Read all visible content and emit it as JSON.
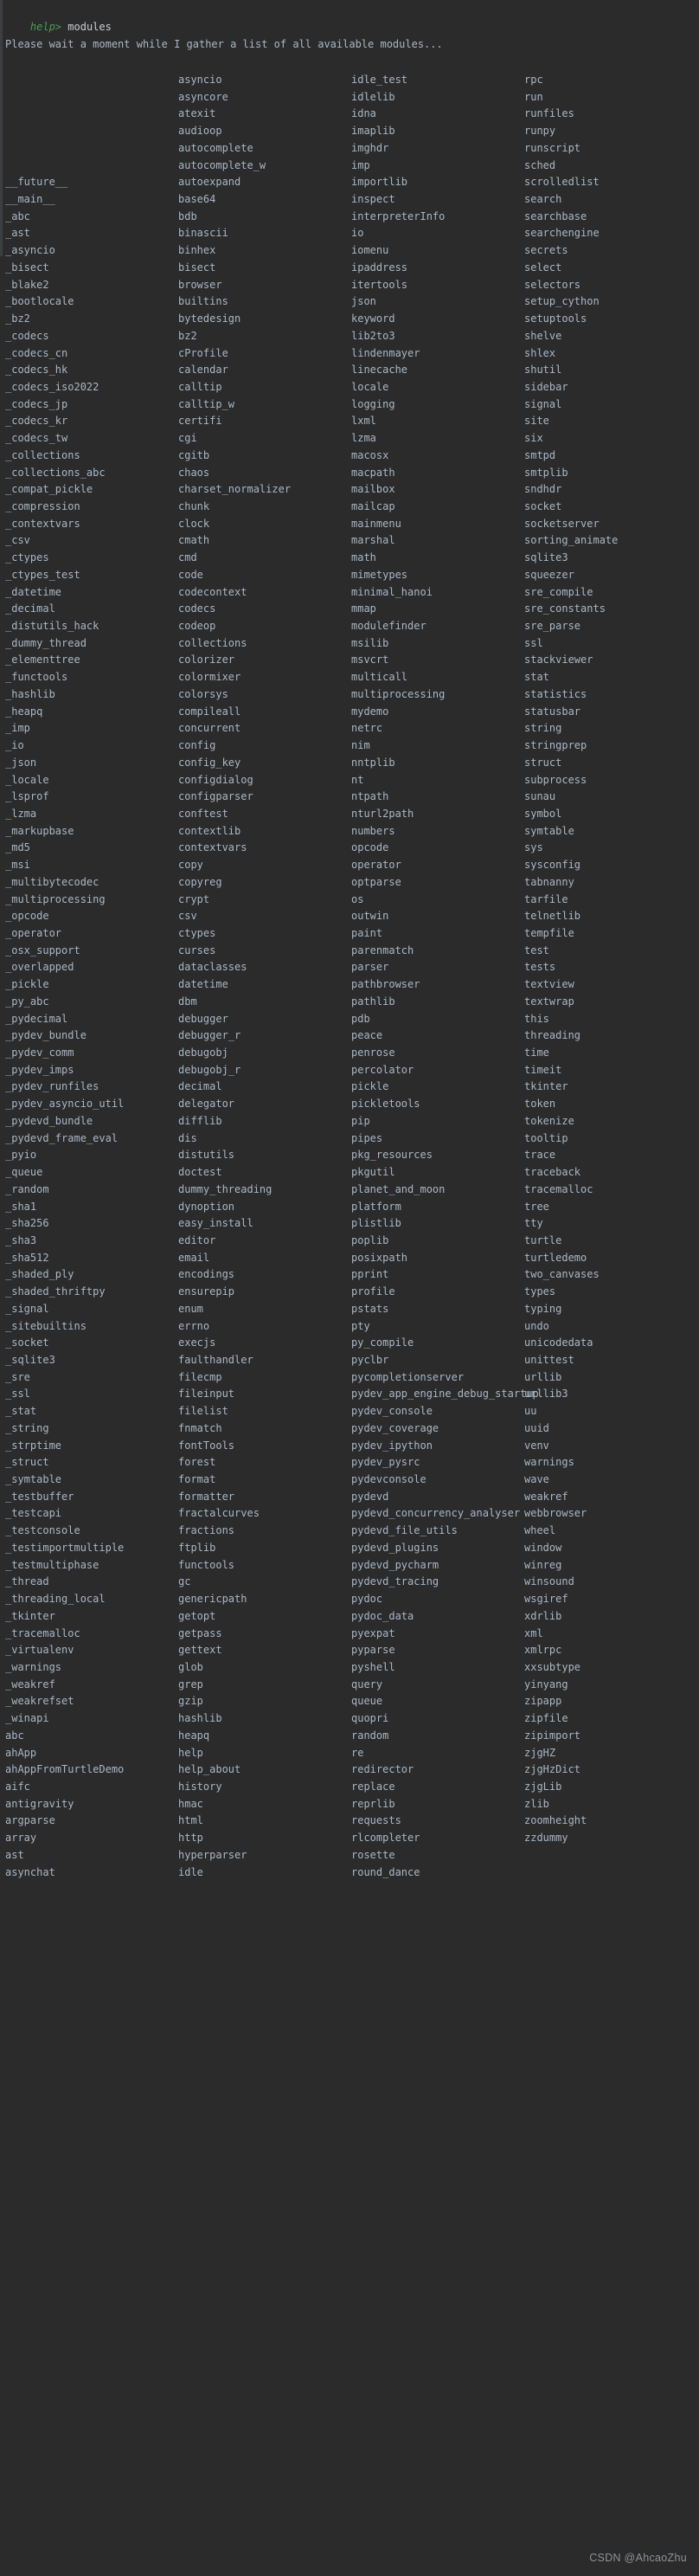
{
  "terminal": {
    "prompt_label": "help>",
    "command": "modules",
    "message": "Please wait a moment while I gather a list of all available modules...",
    "watermark": "CSDN @AhcaoZhu",
    "colors": {
      "background": "#2b2b2b",
      "foreground": "#a9b7c6",
      "prompt": "#499c54",
      "command": "#c8cdd2",
      "watermark": "#8d9299",
      "gutter": "#3c3f41"
    }
  },
  "module_table": {
    "columns": 4,
    "rows": [
      [
        "",
        "asyncio",
        "idle_test",
        "rpc"
      ],
      [
        "",
        "asyncore",
        "idlelib",
        "run"
      ],
      [
        "",
        "atexit",
        "idna",
        "runfiles"
      ],
      [
        "",
        "audioop",
        "imaplib",
        "runpy"
      ],
      [
        "",
        "autocomplete",
        "imghdr",
        "runscript"
      ],
      [
        "",
        "autocomplete_w",
        "imp",
        "sched"
      ],
      [
        "__future__",
        "autoexpand",
        "importlib",
        "scrolledlist"
      ],
      [
        "__main__",
        "base64",
        "inspect",
        "search"
      ],
      [
        "_abc",
        "bdb",
        "interpreterInfo",
        "searchbase"
      ],
      [
        "_ast",
        "binascii",
        "io",
        "searchengine"
      ],
      [
        "_asyncio",
        "binhex",
        "iomenu",
        "secrets"
      ],
      [
        "_bisect",
        "bisect",
        "ipaddress",
        "select"
      ],
      [
        "_blake2",
        "browser",
        "itertools",
        "selectors"
      ],
      [
        "_bootlocale",
        "builtins",
        "json",
        "setup_cython"
      ],
      [
        "_bz2",
        "bytedesign",
        "keyword",
        "setuptools"
      ],
      [
        "_codecs",
        "bz2",
        "lib2to3",
        "shelve"
      ],
      [
        "_codecs_cn",
        "cProfile",
        "lindenmayer",
        "shlex"
      ],
      [
        "_codecs_hk",
        "calendar",
        "linecache",
        "shutil"
      ],
      [
        "_codecs_iso2022",
        "calltip",
        "locale",
        "sidebar"
      ],
      [
        "_codecs_jp",
        "calltip_w",
        "logging",
        "signal"
      ],
      [
        "_codecs_kr",
        "certifi",
        "lxml",
        "site"
      ],
      [
        "_codecs_tw",
        "cgi",
        "lzma",
        "six"
      ],
      [
        "_collections",
        "cgitb",
        "macosx",
        "smtpd"
      ],
      [
        "_collections_abc",
        "chaos",
        "macpath",
        "smtplib"
      ],
      [
        "_compat_pickle",
        "charset_normalizer",
        "mailbox",
        "sndhdr"
      ],
      [
        "_compression",
        "chunk",
        "mailcap",
        "socket"
      ],
      [
        "_contextvars",
        "clock",
        "mainmenu",
        "socketserver"
      ],
      [
        "_csv",
        "cmath",
        "marshal",
        "sorting_animate"
      ],
      [
        "_ctypes",
        "cmd",
        "math",
        "sqlite3"
      ],
      [
        "_ctypes_test",
        "code",
        "mimetypes",
        "squeezer"
      ],
      [
        "_datetime",
        "codecontext",
        "minimal_hanoi",
        "sre_compile"
      ],
      [
        "_decimal",
        "codecs",
        "mmap",
        "sre_constants"
      ],
      [
        "_distutils_hack",
        "codeop",
        "modulefinder",
        "sre_parse"
      ],
      [
        "_dummy_thread",
        "collections",
        "msilib",
        "ssl"
      ],
      [
        "_elementtree",
        "colorizer",
        "msvcrt",
        "stackviewer"
      ],
      [
        "_functools",
        "colormixer",
        "multicall",
        "stat"
      ],
      [
        "_hashlib",
        "colorsys",
        "multiprocessing",
        "statistics"
      ],
      [
        "_heapq",
        "compileall",
        "mydemo",
        "statusbar"
      ],
      [
        "_imp",
        "concurrent",
        "netrc",
        "string"
      ],
      [
        "_io",
        "config",
        "nim",
        "stringprep"
      ],
      [
        "_json",
        "config_key",
        "nntplib",
        "struct"
      ],
      [
        "_locale",
        "configdialog",
        "nt",
        "subprocess"
      ],
      [
        "_lsprof",
        "configparser",
        "ntpath",
        "sunau"
      ],
      [
        "_lzma",
        "conftest",
        "nturl2path",
        "symbol"
      ],
      [
        "_markupbase",
        "contextlib",
        "numbers",
        "symtable"
      ],
      [
        "_md5",
        "contextvars",
        "opcode",
        "sys"
      ],
      [
        "_msi",
        "copy",
        "operator",
        "sysconfig"
      ],
      [
        "_multibytecodec",
        "copyreg",
        "optparse",
        "tabnanny"
      ],
      [
        "_multiprocessing",
        "crypt",
        "os",
        "tarfile"
      ],
      [
        "_opcode",
        "csv",
        "outwin",
        "telnetlib"
      ],
      [
        "_operator",
        "ctypes",
        "paint",
        "tempfile"
      ],
      [
        "_osx_support",
        "curses",
        "parenmatch",
        "test"
      ],
      [
        "_overlapped",
        "dataclasses",
        "parser",
        "tests"
      ],
      [
        "_pickle",
        "datetime",
        "pathbrowser",
        "textview"
      ],
      [
        "_py_abc",
        "dbm",
        "pathlib",
        "textwrap"
      ],
      [
        "_pydecimal",
        "debugger",
        "pdb",
        "this"
      ],
      [
        "_pydev_bundle",
        "debugger_r",
        "peace",
        "threading"
      ],
      [
        "_pydev_comm",
        "debugobj",
        "penrose",
        "time"
      ],
      [
        "_pydev_imps",
        "debugobj_r",
        "percolator",
        "timeit"
      ],
      [
        "_pydev_runfiles",
        "decimal",
        "pickle",
        "tkinter"
      ],
      [
        "_pydev_asyncio_util",
        "delegator",
        "pickletools",
        "token"
      ],
      [
        "_pydevd_bundle",
        "difflib",
        "pip",
        "tokenize"
      ],
      [
        "_pydevd_frame_eval",
        "dis",
        "pipes",
        "tooltip"
      ],
      [
        "_pyio",
        "distutils",
        "pkg_resources",
        "trace"
      ],
      [
        "_queue",
        "doctest",
        "pkgutil",
        "traceback"
      ],
      [
        "_random",
        "dummy_threading",
        "planet_and_moon",
        "tracemalloc"
      ],
      [
        "_sha1",
        "dynoption",
        "platform",
        "tree"
      ],
      [
        "_sha256",
        "easy_install",
        "plistlib",
        "tty"
      ],
      [
        "_sha3",
        "editor",
        "poplib",
        "turtle"
      ],
      [
        "_sha512",
        "email",
        "posixpath",
        "turtledemo"
      ],
      [
        "_shaded_ply",
        "encodings",
        "pprint",
        "two_canvases"
      ],
      [
        "_shaded_thriftpy",
        "ensurepip",
        "profile",
        "types"
      ],
      [
        "_signal",
        "enum",
        "pstats",
        "typing"
      ],
      [
        "_sitebuiltins",
        "errno",
        "pty",
        "undo"
      ],
      [
        "_socket",
        "execjs",
        "py_compile",
        "unicodedata"
      ],
      [
        "_sqlite3",
        "faulthandler",
        "pyclbr",
        "unittest"
      ],
      [
        "_sre",
        "filecmp",
        "pycompletionserver",
        "urllib"
      ],
      [
        "_ssl",
        "fileinput",
        "pydev_app_engine_debug_startup",
        "urllib3"
      ],
      [
        "_stat",
        "filelist",
        "pydev_console",
        "uu"
      ],
      [
        "_string",
        "fnmatch",
        "pydev_coverage",
        "uuid"
      ],
      [
        "_strptime",
        "fontTools",
        "pydev_ipython",
        "venv"
      ],
      [
        "_struct",
        "forest",
        "pydev_pysrc",
        "warnings"
      ],
      [
        "_symtable",
        "format",
        "pydevconsole",
        "wave"
      ],
      [
        "_testbuffer",
        "formatter",
        "pydevd",
        "weakref"
      ],
      [
        "_testcapi",
        "fractalcurves",
        "pydevd_concurrency_analyser",
        "webbrowser"
      ],
      [
        "_testconsole",
        "fractions",
        "pydevd_file_utils",
        "wheel"
      ],
      [
        "_testimportmultiple",
        "ftplib",
        "pydevd_plugins",
        "window"
      ],
      [
        "_testmultiphase",
        "functools",
        "pydevd_pycharm",
        "winreg"
      ],
      [
        "_thread",
        "gc",
        "pydevd_tracing",
        "winsound"
      ],
      [
        "_threading_local",
        "genericpath",
        "pydoc",
        "wsgiref"
      ],
      [
        "_tkinter",
        "getopt",
        "pydoc_data",
        "xdrlib"
      ],
      [
        "_tracemalloc",
        "getpass",
        "pyexpat",
        "xml"
      ],
      [
        "_virtualenv",
        "gettext",
        "pyparse",
        "xmlrpc"
      ],
      [
        "_warnings",
        "glob",
        "pyshell",
        "xxsubtype"
      ],
      [
        "_weakref",
        "grep",
        "query",
        "yinyang"
      ],
      [
        "_weakrefset",
        "gzip",
        "queue",
        "zipapp"
      ],
      [
        "_winapi",
        "hashlib",
        "quopri",
        "zipfile"
      ],
      [
        "abc",
        "heapq",
        "random",
        "zipimport"
      ],
      [
        "ahApp",
        "help",
        "re",
        "zjgHZ"
      ],
      [
        "ahAppFromTurtleDemo",
        "help_about",
        "redirector",
        "zjgHzDict"
      ],
      [
        "aifc",
        "history",
        "replace",
        "zjgLib"
      ],
      [
        "antigravity",
        "hmac",
        "reprlib",
        "zlib"
      ],
      [
        "argparse",
        "html",
        "requests",
        "zoomheight"
      ],
      [
        "array",
        "http",
        "rlcompleter",
        "zzdummy"
      ],
      [
        "ast",
        "hyperparser",
        "rosette",
        ""
      ],
      [
        "asynchat",
        "idle",
        "round_dance",
        ""
      ]
    ]
  }
}
